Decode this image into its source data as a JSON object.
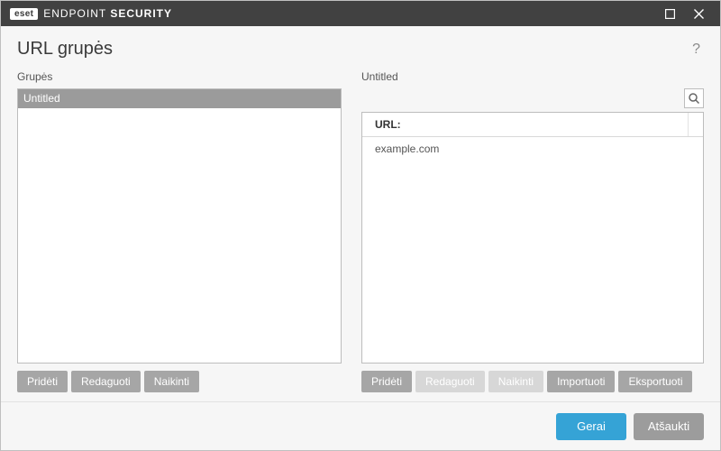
{
  "titlebar": {
    "brand_badge": "eset",
    "brand_light": "ENDPOINT ",
    "brand_bold": "SECURITY"
  },
  "header": {
    "title": "URL grupės",
    "help": "?"
  },
  "left": {
    "label": "Grupės",
    "groups": [
      {
        "name": "Untitled"
      }
    ],
    "btn_add": "Pridėti",
    "btn_edit": "Redaguoti",
    "btn_delete": "Naikinti"
  },
  "right": {
    "label": "Untitled",
    "col_url": "URL:",
    "rows": [
      {
        "url": "example.com"
      }
    ],
    "btn_add": "Pridėti",
    "btn_edit": "Redaguoti",
    "btn_delete": "Naikinti",
    "btn_import": "Importuoti",
    "btn_export": "Eksportuoti"
  },
  "footer": {
    "ok": "Gerai",
    "cancel": "Atšaukti"
  }
}
